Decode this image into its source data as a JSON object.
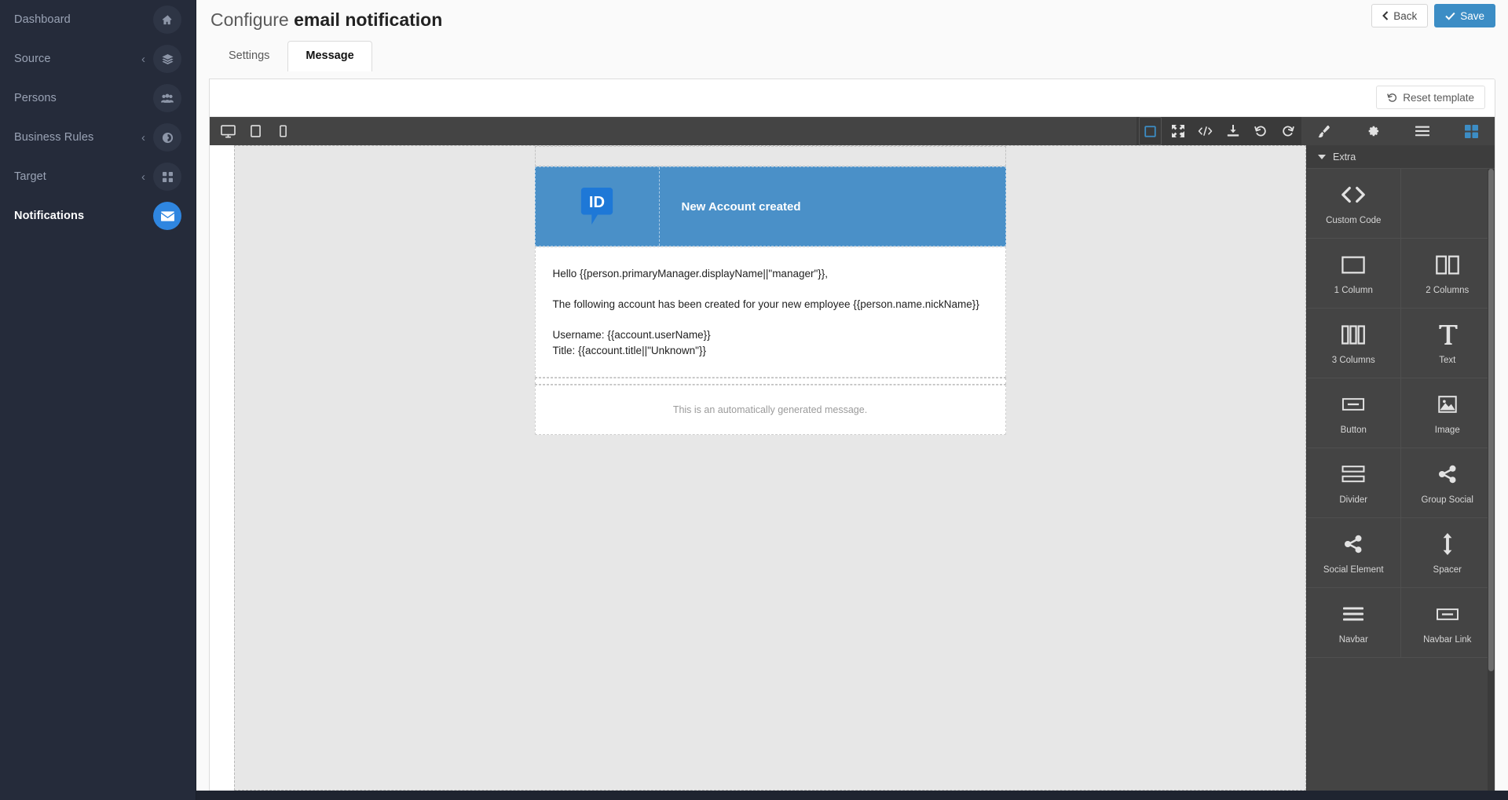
{
  "sidebar": {
    "items": [
      {
        "label": "Dashboard",
        "icon": "home-icon",
        "expandable": false,
        "active": false
      },
      {
        "label": "Source",
        "icon": "layers-icon",
        "expandable": true,
        "active": false
      },
      {
        "label": "Persons",
        "icon": "users-icon",
        "expandable": false,
        "active": false
      },
      {
        "label": "Business Rules",
        "icon": "gears-icon",
        "expandable": true,
        "active": false
      },
      {
        "label": "Target",
        "icon": "grid-icon",
        "expandable": true,
        "active": false
      },
      {
        "label": "Notifications",
        "icon": "envelope-icon",
        "expandable": false,
        "active": true
      }
    ]
  },
  "header": {
    "title_prefix": "Configure ",
    "title_strong": "email notification",
    "back_label": "Back",
    "save_label": "Save"
  },
  "tabs": [
    {
      "label": "Settings",
      "active": false
    },
    {
      "label": "Message",
      "active": true
    }
  ],
  "panel": {
    "reset_label": "Reset template"
  },
  "toolbar": {
    "left": [
      {
        "name": "desktop-view-icon",
        "title": "Desktop"
      },
      {
        "name": "tablet-view-icon",
        "title": "Tablet"
      },
      {
        "name": "mobile-view-icon",
        "title": "Mobile"
      }
    ],
    "right": [
      {
        "name": "borders-toggle-icon",
        "active": true
      },
      {
        "name": "fullscreen-icon",
        "active": false
      },
      {
        "name": "code-view-icon",
        "active": false
      },
      {
        "name": "import-icon",
        "active": false
      },
      {
        "name": "undo-icon",
        "active": false
      },
      {
        "name": "redo-icon",
        "active": false
      },
      {
        "name": "paint-brush-icon",
        "active": false
      },
      {
        "name": "settings-gear-icon",
        "active": false
      },
      {
        "name": "layer-manager-icon",
        "active": false
      },
      {
        "name": "blocks-icon",
        "active": true
      }
    ]
  },
  "email": {
    "header_title": "New Account created",
    "logo_text": "ID",
    "body_lines": [
      "Hello {{person.primaryManager.displayName||\"manager\"}},",
      "The following account has been created for your new employee {{person.name.nickName}}",
      "Username: {{account.userName}}",
      "Title: {{account.title||\"Unknown\"}}"
    ],
    "footer_text": "This is an automatically generated message."
  },
  "blocks_panel": {
    "category": "Extra",
    "blocks": [
      {
        "label": "Custom Code",
        "icon": "code-brackets-icon",
        "wide": true
      },
      {
        "label": "1 Column",
        "icon": "one-column-icon",
        "wide": false
      },
      {
        "label": "2 Columns",
        "icon": "two-columns-icon",
        "wide": false
      },
      {
        "label": "3 Columns",
        "icon": "three-columns-icon",
        "wide": false
      },
      {
        "label": "Text",
        "icon": "text-t-icon",
        "wide": false
      },
      {
        "label": "Button",
        "icon": "button-icon",
        "wide": false
      },
      {
        "label": "Image",
        "icon": "image-icon",
        "wide": false
      },
      {
        "label": "Divider",
        "icon": "divider-icon",
        "wide": false
      },
      {
        "label": "Group Social",
        "icon": "share-icon",
        "wide": false
      },
      {
        "label": "Social Element",
        "icon": "share-icon",
        "wide": false
      },
      {
        "label": "Spacer",
        "icon": "spacer-arrows-icon",
        "wide": false
      },
      {
        "label": "Navbar",
        "icon": "navbar-icon",
        "wide": false
      },
      {
        "label": "Navbar Link",
        "icon": "navbar-link-icon",
        "wide": false
      }
    ]
  },
  "colors": {
    "sidebar_bg": "#252b3a",
    "accent": "#2f86e0",
    "primary_button": "#3c8dc5",
    "email_header": "#4a90c8",
    "editor_chrome": "#444444"
  }
}
